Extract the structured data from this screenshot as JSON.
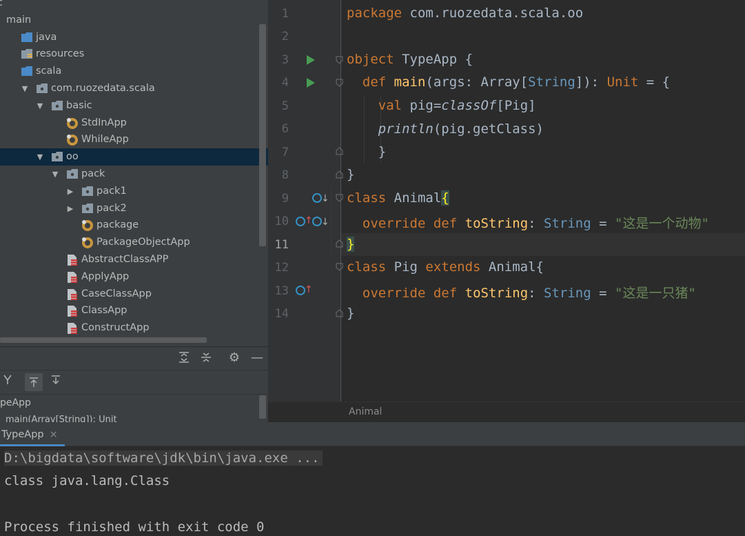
{
  "project_tree": {
    "items": [
      {
        "label": "c",
        "indent": 0,
        "arrow": "",
        "icon": "none"
      },
      {
        "label": "main",
        "indent": 0,
        "arrow": "",
        "icon": "none"
      },
      {
        "label": "java",
        "indent": 1,
        "arrow": "",
        "icon": "folder-blue"
      },
      {
        "label": "resources",
        "indent": 1,
        "arrow": "",
        "icon": "folder-resources"
      },
      {
        "label": "scala",
        "indent": 1,
        "arrow": "",
        "icon": "folder-blue"
      },
      {
        "label": "com.ruozedata.scala",
        "indent": 1,
        "arrow": "▼",
        "icon": "package"
      },
      {
        "label": "basic",
        "indent": 2,
        "arrow": "▼",
        "icon": "package"
      },
      {
        "label": "StdInApp",
        "indent": 3,
        "arrow": "",
        "icon": "scala-object"
      },
      {
        "label": "WhileApp",
        "indent": 3,
        "arrow": "",
        "icon": "scala-object"
      },
      {
        "label": "oo",
        "indent": 2,
        "arrow": "▼",
        "icon": "package",
        "selected": true
      },
      {
        "label": "pack",
        "indent": 3,
        "arrow": "▼",
        "icon": "package"
      },
      {
        "label": "pack1",
        "indent": 4,
        "arrow": "▶",
        "icon": "package"
      },
      {
        "label": "pack2",
        "indent": 4,
        "arrow": "▶",
        "icon": "package"
      },
      {
        "label": "package",
        "indent": 4,
        "arrow": "",
        "icon": "scala-object"
      },
      {
        "label": "PackageObjectApp",
        "indent": 4,
        "arrow": "",
        "icon": "scala-object"
      },
      {
        "label": "AbstractClassAPP",
        "indent": 3,
        "arrow": "",
        "icon": "scala-file"
      },
      {
        "label": "ApplyApp",
        "indent": 3,
        "arrow": "",
        "icon": "scala-file"
      },
      {
        "label": "CaseClassApp",
        "indent": 3,
        "arrow": "",
        "icon": "scala-file"
      },
      {
        "label": "ClassApp",
        "indent": 3,
        "arrow": "",
        "icon": "scala-file"
      },
      {
        "label": "ConstructApp",
        "indent": 3,
        "arrow": "",
        "icon": "scala-file"
      }
    ]
  },
  "structure_panel": {
    "toolbar_icons": [
      "expand-all-icon",
      "collapse-all-icon",
      "settings-icon",
      "hide-icon"
    ],
    "toolbar2_icons": [
      "sort-icon",
      "scroll-from-source-icon",
      "scroll-to-source-icon"
    ],
    "root_label": "peApp",
    "child_label": "main(Array[String]): Unit"
  },
  "editor": {
    "line_numbers": [
      "1",
      "2",
      "3",
      "4",
      "5",
      "6",
      "7",
      "8",
      "9",
      "10",
      "11",
      "12",
      "13",
      "14"
    ],
    "current_line": 11,
    "breadcrumb": "Animal",
    "accent": "#cc7832"
  },
  "run_panel": {
    "tab_label": "TypeApp",
    "tab_close": "×",
    "console_lines": [
      "D:\\bigdata\\software\\jdk\\bin\\java.exe ...",
      "class java.lang.Class",
      "",
      "Process finished with exit code 0"
    ]
  }
}
